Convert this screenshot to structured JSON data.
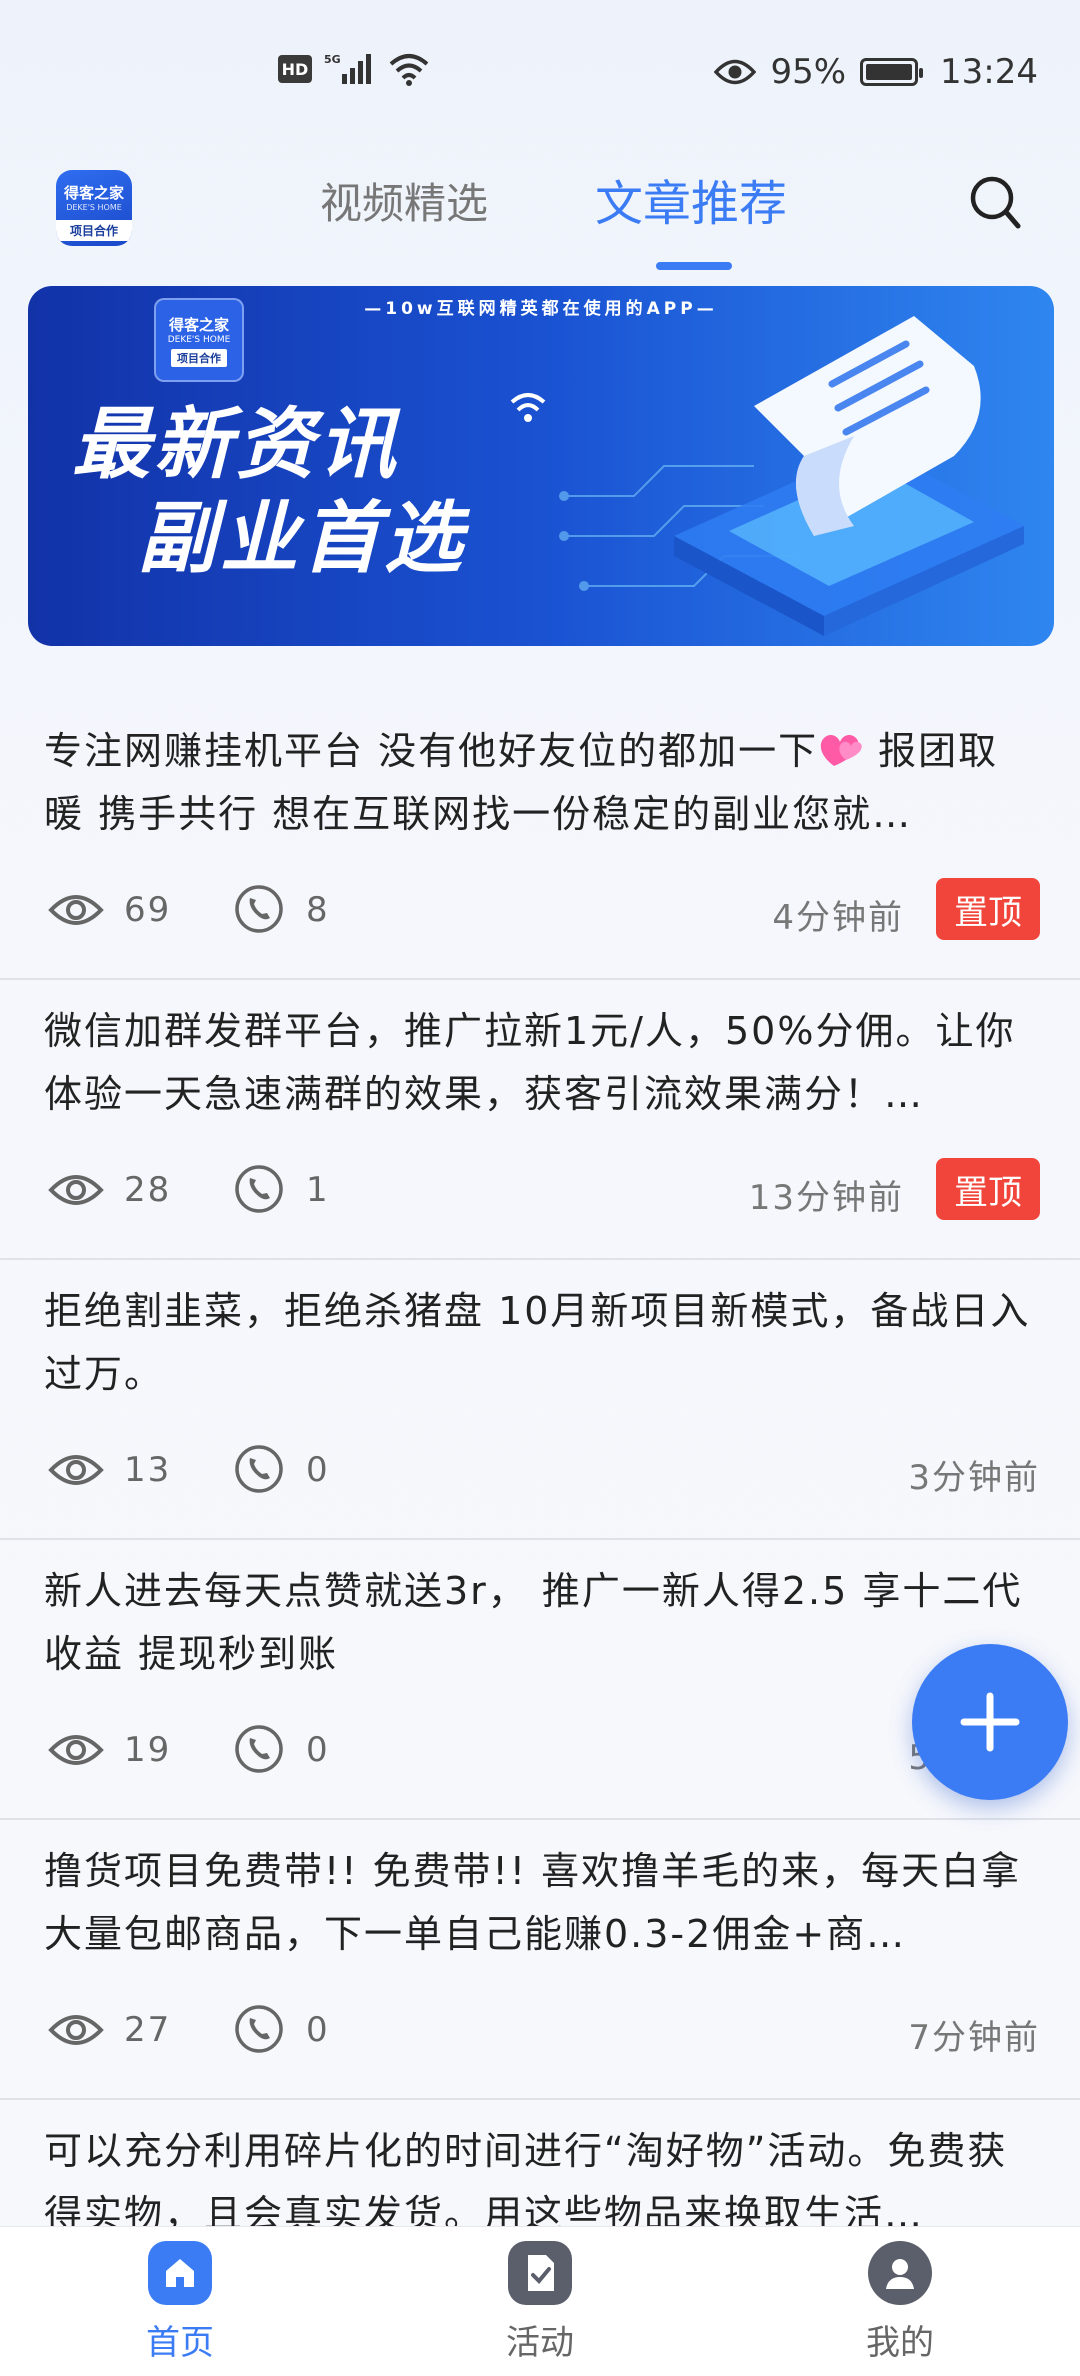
{
  "status_bar": {
    "hd_label": "HD",
    "network_label": "5G",
    "battery_percent": "95%",
    "battery_level": 0.95,
    "time": "13:24"
  },
  "header": {
    "logo": {
      "name": "得客之家",
      "subtitle": "DEKE'S HOME",
      "tag": "项目合作"
    },
    "tabs": [
      {
        "label": "视频精选",
        "active": false
      },
      {
        "label": "文章推荐",
        "active": true
      }
    ],
    "accent_color": "#3b7cf5"
  },
  "banner": {
    "tagline": "—10w互联网精英都在使用的APP—",
    "line1": "最新资讯",
    "line2": "副业首选"
  },
  "posts": [
    {
      "text_before": "专注网赚挂机平台 没有他好友位的都加一下",
      "emoji": "heart-emoji",
      "text_after": " 报团取暖 携手共行 想在互联网找一份稳定的副业您就…",
      "views": "69",
      "comments": "8",
      "time": "4分钟前",
      "pinned": true,
      "pin_label": "置顶"
    },
    {
      "text": "微信加群发群平台，推广拉新1元/人，50%分佣。让你体验一天急速满群的效果，获客引流效果满分！…",
      "views": "28",
      "comments": "1",
      "time": "13分钟前",
      "pinned": true,
      "pin_label": "置顶"
    },
    {
      "text": "拒绝割韭菜，拒绝杀猪盘 10月新项目新模式，备战日入过万。",
      "views": "13",
      "comments": "0",
      "time": "3分钟前",
      "pinned": false
    },
    {
      "text": "新人进去每天点赞就送3r， 推广一新人得2.5 享十二代收益 提现秒到账",
      "views": "19",
      "comments": "0",
      "time": "5分钟前",
      "pinned": false
    },
    {
      "text": "撸货项目免费带!! 免费带!! 喜欢撸羊毛的来，每天白拿大量包邮商品，下一单自己能赚0.3-2佣金+商…",
      "views": "27",
      "comments": "0",
      "time": "7分钟前",
      "pinned": false
    },
    {
      "text": "可以充分利用碎片化的时间进行“淘好物”活动。免费获得实物，且会真实发货。用这些物品来换取生活…",
      "views": "",
      "comments": "",
      "time": "",
      "pinned": false
    }
  ],
  "bottom_nav": [
    {
      "label": "首页",
      "icon": "home-icon",
      "active": true
    },
    {
      "label": "活动",
      "icon": "activity-icon",
      "active": false
    },
    {
      "label": "我的",
      "icon": "profile-icon",
      "active": false
    }
  ],
  "colors": {
    "accent": "#3b7cf5",
    "pin_badge": "#f1443a",
    "banner_dark": "#1232a8",
    "banner_light": "#2f86f0"
  }
}
